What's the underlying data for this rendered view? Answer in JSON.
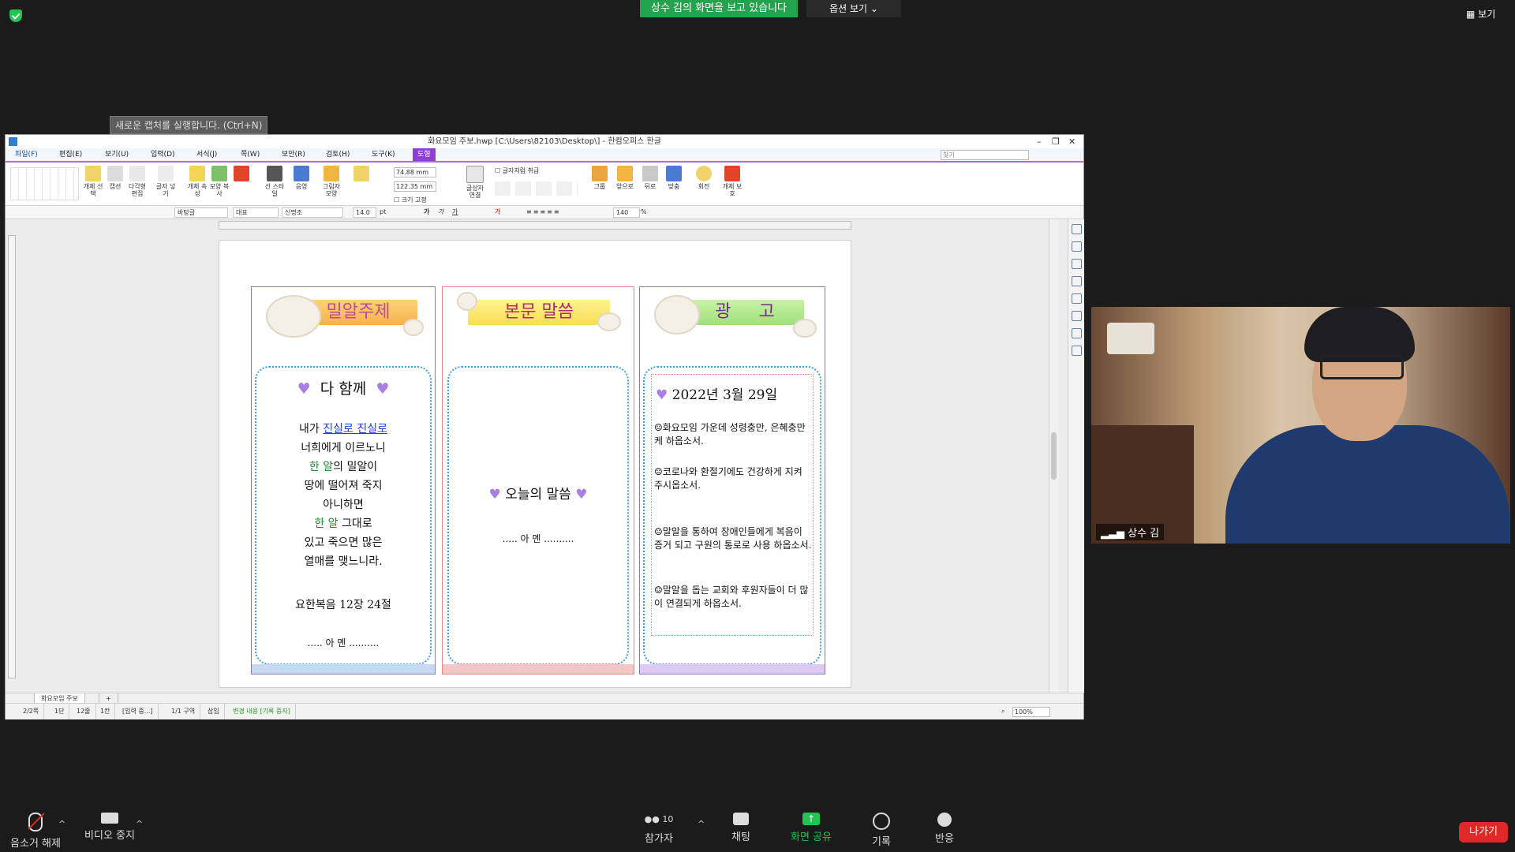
{
  "zoom": {
    "share_banner": "상수 김의 화면을 보고 있습니다",
    "view_options": "옵션 보기 ⌄",
    "view_button": "보기",
    "capture_tip": "새로운 캡처를 실행합니다. (Ctrl+N)",
    "participant_count": "10",
    "controls": {
      "mute": "음소거 해제",
      "video": "비디오 중지",
      "participants": "참가자",
      "chat": "채팅",
      "share": "화면 공유",
      "record": "기록",
      "reactions": "반응",
      "leave": "나가기"
    },
    "camera_name": "상수 김"
  },
  "hwp": {
    "title": "화요모임 주보.hwp [C:\\Users\\82103\\Desktop\\] - 한컴오피스 한글",
    "menus": [
      "파일(F)",
      "편집(E)",
      "보기(U)",
      "입력(D)",
      "서식(J)",
      "쪽(W)",
      "보안(R)",
      "검토(H)",
      "도구(K)",
      "도형"
    ],
    "search_placeholder": "찾기",
    "ribbon": {
      "select_object": "개체 선택",
      "caption": "캡션",
      "polygon_edit": "다각형 편집",
      "text_wrap": "글자 넣기",
      "object_props": "개체 속성",
      "shape_outline": "모양 복사",
      "line_style": "선 스타일",
      "shadow": "음영",
      "picture_shape": "그림자 모양",
      "width": "74.88",
      "height": "122.35",
      "unit": "mm",
      "fix_size": "크기 고정",
      "text_wrap_opt": "글자처럼 취급",
      "textbox_link": "글상자 연결",
      "group": "그룹",
      "bring_front": "앞으로",
      "send_back": "뒤로",
      "align": "맞춤",
      "rotate": "회전",
      "protect": "개체 보호"
    },
    "format": {
      "style": "바탕글",
      "lang": "대표",
      "font": "신명조",
      "size": "14.0",
      "size_unit": "pt",
      "zoom_pct": "140",
      "pct": "%"
    },
    "columns": {
      "left": {
        "banner": "밀알주제",
        "heading": "다 함께",
        "lines": [
          {
            "parts": [
              {
                "t": "내가 ",
                "c": ""
              },
              {
                "t": "진실로 진실로",
                "c": "blue"
              }
            ]
          },
          {
            "parts": [
              {
                "t": "너희에게 이르노니",
                "c": ""
              }
            ]
          },
          {
            "parts": [
              {
                "t": "한 알",
                "c": "green"
              },
              {
                "t": "의 밀알이",
                "c": ""
              }
            ]
          },
          {
            "parts": [
              {
                "t": "땅에 떨어져 죽지",
                "c": ""
              }
            ]
          },
          {
            "parts": [
              {
                "t": "아니하면",
                "c": ""
              }
            ]
          },
          {
            "parts": [
              {
                "t": "한 알",
                "c": "green"
              },
              {
                "t": " 그대로",
                "c": ""
              }
            ]
          },
          {
            "parts": [
              {
                "t": "있고 죽으면 많은",
                "c": ""
              }
            ]
          },
          {
            "parts": [
              {
                "t": "열매를 맺느니라.",
                "c": ""
              }
            ]
          }
        ],
        "reference": "요한복음 12장 24절",
        "amen": "..... 아 멘 ..........",
        "footer_color": "#c8d8f5"
      },
      "middle": {
        "banner": "본문 말씀",
        "heading": "오늘의 말씀",
        "amen": "..... 아 멘 ..........",
        "footer_color": "#f5c6c6"
      },
      "right": {
        "banner": "광     고",
        "date": "2022년 3월 29일",
        "items": [
          "☺화요모임 가운데 성령충만, 은혜충만케 하옵소서.",
          "☺코로나와 환절기에도 건강하게 지켜 주시옵소서.",
          "☺말알을 통하여 장애인들에게 복음이 증거 되고 구원의 통로로 사용 하옵소서.",
          "☺말알을 돕는 교회와 후원자들이 더 많이 연결되게 하옵소서."
        ],
        "footer_color": "#ddc9f3"
      }
    },
    "tab_name": "화요모임 주보",
    "status": [
      "2/2쪽",
      "1단",
      "12줄",
      "1칸",
      "[입력 중...]",
      "1/1 구역",
      "삽입",
      "변경 내용 [기록 중지]"
    ],
    "zoom_level": "100%"
  },
  "colors": {
    "share_green": "#23a34d",
    "leave_red": "#e02828",
    "menu_accent": "#8e3fd5"
  }
}
